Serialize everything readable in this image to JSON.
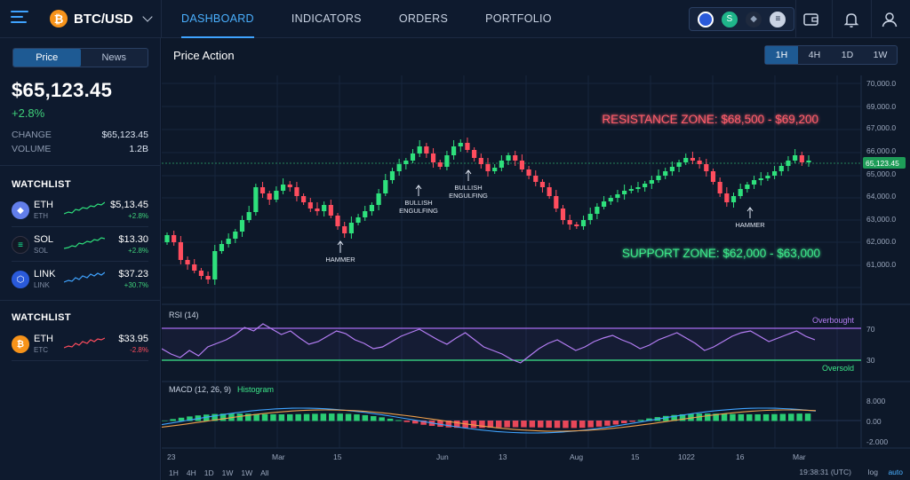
{
  "topbar": {
    "pair": "BTC/USD",
    "nav": [
      "DASHBOARD",
      "INDICATORS",
      "ORDERS",
      "PORTFOLIO"
    ],
    "active_tab": "DASHBOARD"
  },
  "sidebar": {
    "tabs": [
      "Price",
      "News"
    ],
    "price": "$65,123.45",
    "change_pct": "+2.8%",
    "change_label": "CHANGE",
    "change_value": "$65,123.45",
    "volume_label": "VOLUME",
    "volume_value": "1.2B",
    "watchlist1_title": "WATCHLIST",
    "watchlist1": [
      {
        "symbol": "ETH",
        "sub": "ETH",
        "price": "$5,13.45",
        "change": "+2.8%",
        "color": "#627eea"
      },
      {
        "symbol": "SOL",
        "sub": "SOL",
        "price": "$13.30",
        "change": "+2.8%",
        "color": "#1a1a2e"
      },
      {
        "symbol": "LINK",
        "sub": "LINK",
        "price": "$37.23",
        "change": "+30.7%",
        "color": "#2a5ada"
      }
    ],
    "watchlist2_title": "WATCHLIST",
    "watchlist2": [
      {
        "symbol": "ETH",
        "sub": "ETC",
        "price": "$33.95",
        "change": "-2.8%",
        "color": "#f7931a"
      }
    ]
  },
  "main": {
    "title": "Price Action",
    "timeframes": [
      "1H",
      "4H",
      "1D",
      "1W"
    ],
    "active_timeframe": "1H",
    "resistance_label": "RESISTANCE ZONE: $68,500 - $69,200",
    "support_label": "SUPPORT ZONE: $62,000 - $63,000",
    "price_ticks": [
      "70,000.0",
      "69,000.0",
      "67,000.0",
      "66,000.0",
      "65,000.0",
      "64,000.0",
      "63,000.0",
      "62,000.0",
      "61,000.0"
    ],
    "current_price_tag": "65,123.45",
    "annotations": {
      "hammer1": "HAMMER",
      "bullish1_a": "BULLISH",
      "bullish1_b": "ENGULFING",
      "bullish2_a": "BULLISH",
      "bullish2_b": "ENGULFING",
      "hammer2": "HAMMER"
    },
    "rsi": {
      "label": "RSI (14)",
      "overbought": "Overbought",
      "oversold": "Oversold",
      "tick_high": "70",
      "tick_low": "30"
    },
    "macd": {
      "label": "MACD (12, 26, 9)",
      "hist_label": "Histogram",
      "ticks": [
        "8.000",
        "0.00",
        "-2.000"
      ]
    },
    "x_ticks": [
      "23",
      "Mar",
      "15",
      "Jun",
      "13",
      "Aug",
      "15",
      "1022",
      "16",
      "Mar"
    ],
    "bottom_tf": [
      "1H",
      "4H",
      "1D",
      "1W",
      "1W",
      "All"
    ],
    "clock": "19:38:31 (UTC)",
    "log": "log",
    "auto": "auto"
  },
  "colors": {
    "up": "#2ee07c",
    "down": "#ff4d5e",
    "accent": "#3fa3ff",
    "rsi": "#a86bf0"
  }
}
